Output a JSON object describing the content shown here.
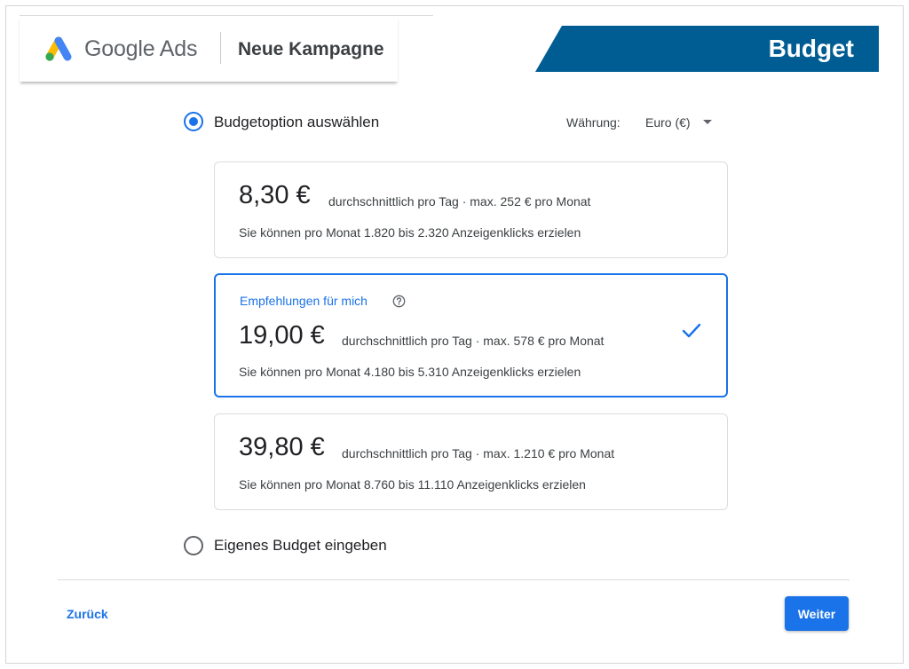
{
  "header": {
    "brand": "Google Ads",
    "campaign_title": "Neue Kampagne",
    "section_banner": "Budget"
  },
  "budget_option": {
    "label": "Budgetoption auswählen",
    "selected": true
  },
  "currency": {
    "label": "Währung:",
    "value": "Euro (€)"
  },
  "options": [
    {
      "price": "8,30 €",
      "meta": "durchschnittlich pro Tag · max. 252 € pro Monat",
      "clicks": "Sie können pro Monat 1.820 bis 2.320 Anzeigenklicks erzielen",
      "selected": false
    },
    {
      "recommendation": "Empfehlungen für mich",
      "price": "19,00 €",
      "meta": "durchschnittlich pro Tag · max. 578 € pro Monat",
      "clicks": "Sie können pro Monat 4.180 bis 5.310 Anzeigenklicks erzielen",
      "selected": true
    },
    {
      "price": "39,80 €",
      "meta": "durchschnittlich pro Tag · max. 1.210 € pro Monat",
      "clicks": "Sie können pro Monat 8.760 bis 11.110 Anzeigenklicks erzielen",
      "selected": false
    }
  ],
  "custom_budget": {
    "label": "Eigenes Budget eingeben",
    "selected": false
  },
  "footer": {
    "back_label": "Zurück",
    "next_label": "Weiter"
  },
  "colors": {
    "accent": "#1a73e8",
    "banner": "#005d94",
    "logo_yellow": "#fbbc04",
    "logo_blue": "#4285f4",
    "logo_green": "#34a853"
  },
  "icons": {
    "logo": "google-ads-logo-icon",
    "help": "help-circle-icon",
    "check": "check-icon",
    "dropdown": "caret-down-icon"
  }
}
